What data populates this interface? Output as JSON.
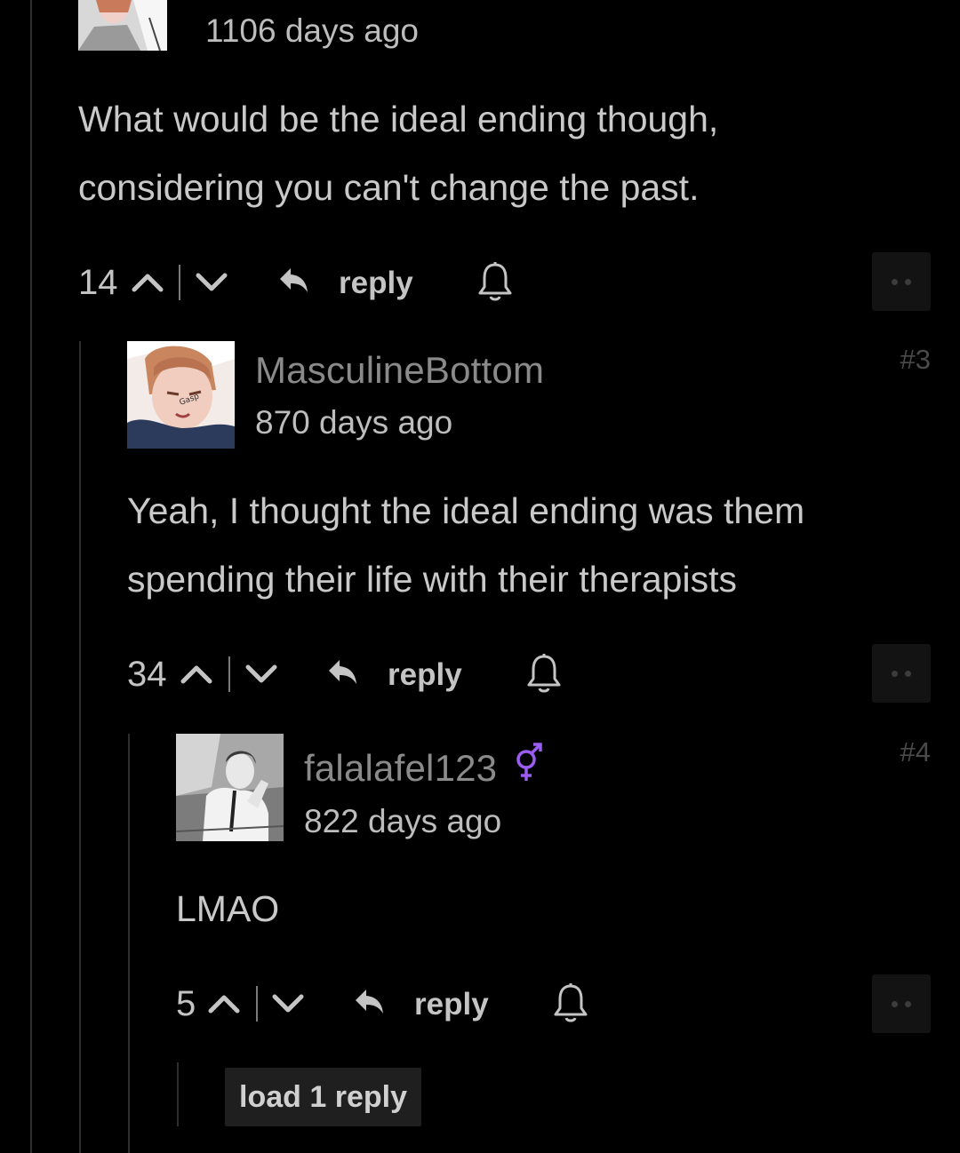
{
  "comments": [
    {
      "time": "1106 days ago",
      "body_line1": "What would be the ideal ending though,",
      "body_line2": "considering you can't change the past.",
      "votes": "14",
      "reply_label": "reply"
    },
    {
      "username": "MasculineBottom",
      "number": "#3",
      "time": "870 days ago",
      "body_line1": "Yeah, I thought the ideal ending was them",
      "body_line2": "spending their life with their therapists",
      "votes": "34",
      "reply_label": "reply"
    },
    {
      "username": "falalafel123",
      "gender_icon": "genderfluid-symbol-icon",
      "number": "#4",
      "time": "822 days ago",
      "body_line1": "LMAO",
      "votes": "5",
      "reply_label": "reply",
      "load_more": "load 1 reply"
    }
  ],
  "colors": {
    "background": "#000000",
    "accent_gender": "#9b5cf0"
  }
}
